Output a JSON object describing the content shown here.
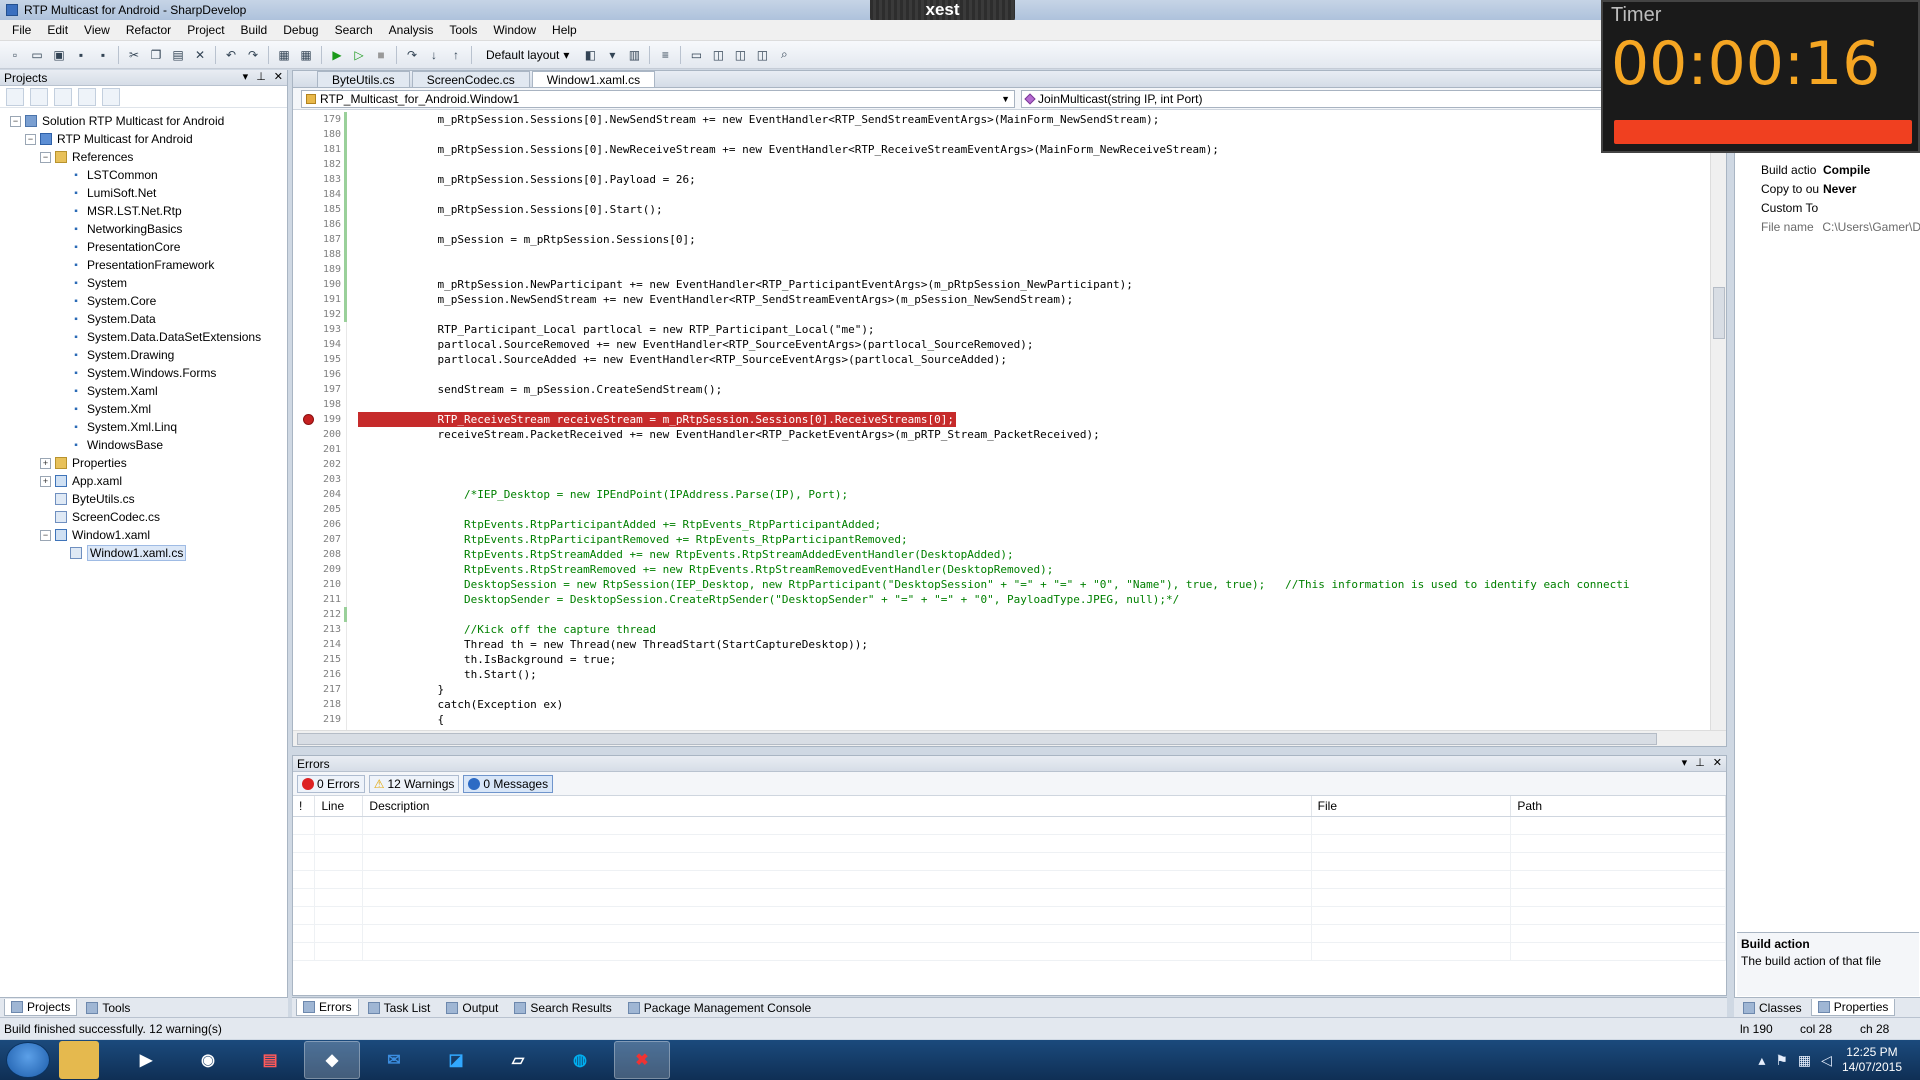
{
  "window": {
    "title": "RTP Multicast for Android - SharpDevelop"
  },
  "overlay": {
    "xest_label": "xest"
  },
  "timer": {
    "label": "Timer",
    "value": "00:00:16"
  },
  "menu": [
    "File",
    "Edit",
    "View",
    "Refactor",
    "Project",
    "Build",
    "Debug",
    "Search",
    "Analysis",
    "Tools",
    "Window",
    "Help"
  ],
  "toolbar": {
    "layout_combo": "Default layout"
  },
  "projects": {
    "header": "Projects",
    "tree": [
      {
        "label": "Solution RTP Multicast for Android",
        "indent": 0,
        "icon": "solution-icon",
        "exp": "-"
      },
      {
        "label": "RTP Multicast for Android",
        "indent": 1,
        "icon": "project-icon",
        "exp": "-"
      },
      {
        "label": "References",
        "indent": 2,
        "icon": "folder-icon",
        "exp": "-"
      },
      {
        "label": "LSTCommon",
        "indent": 3,
        "icon": "reference-icon"
      },
      {
        "label": "LumiSoft.Net",
        "indent": 3,
        "icon": "reference-icon"
      },
      {
        "label": "MSR.LST.Net.Rtp",
        "indent": 3,
        "icon": "reference-icon"
      },
      {
        "label": "NetworkingBasics",
        "indent": 3,
        "icon": "reference-icon"
      },
      {
        "label": "PresentationCore",
        "indent": 3,
        "icon": "reference-icon"
      },
      {
        "label": "PresentationFramework",
        "indent": 3,
        "icon": "reference-icon"
      },
      {
        "label": "System",
        "indent": 3,
        "icon": "reference-icon"
      },
      {
        "label": "System.Core",
        "indent": 3,
        "icon": "reference-icon"
      },
      {
        "label": "System.Data",
        "indent": 3,
        "icon": "reference-icon"
      },
      {
        "label": "System.Data.DataSetExtensions",
        "indent": 3,
        "icon": "reference-icon"
      },
      {
        "label": "System.Drawing",
        "indent": 3,
        "icon": "reference-icon"
      },
      {
        "label": "System.Windows.Forms",
        "indent": 3,
        "icon": "reference-icon"
      },
      {
        "label": "System.Xaml",
        "indent": 3,
        "icon": "reference-icon"
      },
      {
        "label": "System.Xml",
        "indent": 3,
        "icon": "reference-icon"
      },
      {
        "label": "System.Xml.Linq",
        "indent": 3,
        "icon": "reference-icon"
      },
      {
        "label": "WindowsBase",
        "indent": 3,
        "icon": "reference-icon"
      },
      {
        "label": "Properties",
        "indent": 2,
        "icon": "folder-icon",
        "exp": "+"
      },
      {
        "label": "App.xaml",
        "indent": 2,
        "icon": "xaml-file-icon",
        "exp": "+"
      },
      {
        "label": "ByteUtils.cs",
        "indent": 2,
        "icon": "cs-file-icon"
      },
      {
        "label": "ScreenCodec.cs",
        "indent": 2,
        "icon": "cs-file-icon"
      },
      {
        "label": "Window1.xaml",
        "indent": 2,
        "icon": "xaml-file-icon",
        "exp": "-"
      },
      {
        "label": "Window1.xaml.cs",
        "indent": 3,
        "icon": "cs-file-icon",
        "selected": true
      }
    ],
    "bottom_tabs": [
      "Projects",
      "Tools"
    ]
  },
  "editor": {
    "tabs": [
      "ByteUtils.cs",
      "ScreenCodec.cs",
      "Window1.xaml.cs"
    ],
    "active_tab": 2,
    "class_combo": "RTP_Multicast_for_Android.Window1",
    "member_combo": "JoinMulticast(string IP, int Port)",
    "lines": [
      {
        "n": "179",
        "t": "            m_pRtpSession.Sessions[0].NewSendStream += new EventHandler<RTP_SendStreamEventArgs>(MainForm_NewSendStream);"
      },
      {
        "n": "180",
        "t": ""
      },
      {
        "n": "181",
        "t": "            m_pRtpSession.Sessions[0].NewReceiveStream += new EventHandler<RTP_ReceiveStreamEventArgs>(MainForm_NewReceiveStream);"
      },
      {
        "n": "182",
        "t": ""
      },
      {
        "n": "183",
        "t": "            m_pRtpSession.Sessions[0].Payload = 26;"
      },
      {
        "n": "184",
        "t": ""
      },
      {
        "n": "185",
        "t": "            m_pRtpSession.Sessions[0].Start();"
      },
      {
        "n": "186",
        "t": ""
      },
      {
        "n": "187",
        "t": "            m_pSession = m_pRtpSession.Sessions[0];"
      },
      {
        "n": "188",
        "t": ""
      },
      {
        "n": "189",
        "t": ""
      },
      {
        "n": "190",
        "t": "            m_pRtpSession.NewParticipant += new EventHandler<RTP_ParticipantEventArgs>(m_pRtpSession_NewParticipant);"
      },
      {
        "n": "191",
        "t": "            m_pSession.NewSendStream += new EventHandler<RTP_SendStreamEventArgs>(m_pSession_NewSendStream);"
      },
      {
        "n": "192",
        "t": ""
      },
      {
        "n": "193",
        "t": "            RTP_Participant_Local partlocal = new RTP_Participant_Local(\"me\");"
      },
      {
        "n": "194",
        "t": "            partlocal.SourceRemoved += new EventHandler<RTP_SourceEventArgs>(partlocal_SourceRemoved);"
      },
      {
        "n": "195",
        "t": "            partlocal.SourceAdded += new EventHandler<RTP_SourceEventArgs>(partlocal_SourceAdded);"
      },
      {
        "n": "196",
        "t": ""
      },
      {
        "n": "197",
        "t": "            sendStream = m_pSession.CreateSendStream();"
      },
      {
        "n": "198",
        "t": ""
      },
      {
        "n": "199",
        "t": "            RTP_ReceiveStream receiveStream = m_pRtpSession.Sessions[0].ReceiveStreams[0];",
        "bp": true
      },
      {
        "n": "200",
        "t": "            receiveStream.PacketReceived += new EventHandler<RTP_PacketEventArgs>(m_pRTP_Stream_PacketReceived);"
      },
      {
        "n": "201",
        "t": ""
      },
      {
        "n": "202",
        "t": ""
      },
      {
        "n": "203",
        "t": ""
      },
      {
        "n": "204",
        "t": "                /*IEP_Desktop = new IPEndPoint(IPAddress.Parse(IP), Port);",
        "c": true
      },
      {
        "n": "205",
        "t": "",
        "c": true
      },
      {
        "n": "206",
        "t": "                RtpEvents.RtpParticipantAdded += RtpEvents_RtpParticipantAdded;",
        "c": true
      },
      {
        "n": "207",
        "t": "                RtpEvents.RtpParticipantRemoved += RtpEvents_RtpParticipantRemoved;",
        "c": true
      },
      {
        "n": "208",
        "t": "                RtpEvents.RtpStreamAdded += new RtpEvents.RtpStreamAddedEventHandler(DesktopAdded);",
        "c": true
      },
      {
        "n": "209",
        "t": "                RtpEvents.RtpStreamRemoved += new RtpEvents.RtpStreamRemovedEventHandler(DesktopRemoved);",
        "c": true
      },
      {
        "n": "210",
        "t": "                DesktopSession = new RtpSession(IEP_Desktop, new RtpParticipant(\"DesktopSession\" + \"=\" + \"=\" + \"0\", \"Name\"), true, true);   //This information is used to identify each connecti",
        "c": true
      },
      {
        "n": "211",
        "t": "                DesktopSender = DesktopSession.CreateRtpSender(\"DesktopSender\" + \"=\" + \"=\" + \"0\", PayloadType.JPEG, null);*/",
        "c": true
      },
      {
        "n": "212",
        "t": ""
      },
      {
        "n": "213",
        "t": "                //Kick off the capture thread",
        "c": true
      },
      {
        "n": "214",
        "t": "                Thread th = new Thread(new ThreadStart(StartCaptureDesktop));"
      },
      {
        "n": "215",
        "t": "                th.IsBackground = true;"
      },
      {
        "n": "216",
        "t": "                th.Start();"
      },
      {
        "n": "217",
        "t": "            }"
      },
      {
        "n": "218",
        "t": "            catch(Exception ex)"
      },
      {
        "n": "219",
        "t": "            {"
      }
    ]
  },
  "errors": {
    "header": "Errors",
    "buttons": {
      "errors": "0 Errors",
      "warnings": "12 Warnings",
      "messages": "0 Messages"
    },
    "columns": [
      "!",
      "Line",
      "Description",
      "File",
      "Path"
    ],
    "bottom_tabs": [
      "Errors",
      "Task List",
      "Output",
      "Search Results",
      "Package Management Console"
    ]
  },
  "properties": {
    "rows": [
      {
        "name": "Build actio",
        "value": "Compile"
      },
      {
        "name": "Copy to ou",
        "value": "Never"
      },
      {
        "name": "Custom To",
        "value": ""
      },
      {
        "name": "File name",
        "value": "C:\\Users\\Gamer\\D",
        "grey": true
      }
    ],
    "desc_title": "Build action",
    "desc_text": "The build action of that file",
    "bottom_tabs": [
      "Classes",
      "Properties"
    ]
  },
  "status": {
    "message": "Build finished successfully. 12 warning(s)",
    "line": "ln 190",
    "col": "col 28",
    "ch": "ch 28"
  },
  "taskbar": {
    "clock_time": "12:25 PM",
    "clock_date": "14/07/2015"
  }
}
